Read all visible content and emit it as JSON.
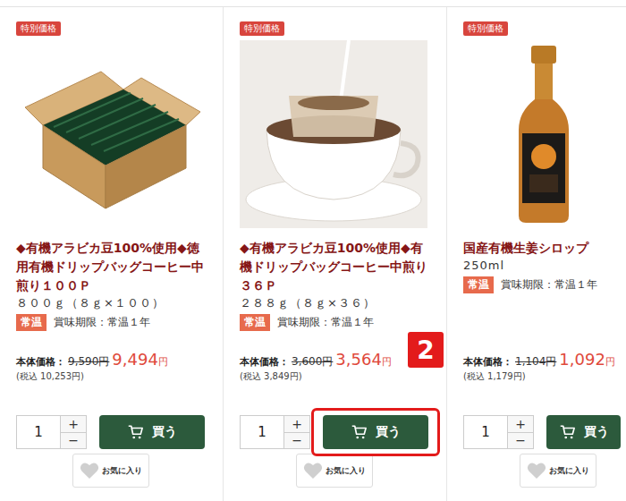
{
  "products": [
    {
      "badge": "特別価格",
      "kind": "box",
      "title": "◆有機アラビカ豆100%使用◆徳用有機ドリップバッグコーヒー中煎り１００Ｐ",
      "spec": "８００ｇ（８ｇ×１００）",
      "storage": "常温",
      "expiry": "賞味期限：常温１年",
      "price_label": "本体価格：",
      "original_price": "9,590円",
      "sale_price": "9,494",
      "sale_unit": "円",
      "tax_price": "(税込 10,253円)",
      "quantity": "1",
      "buy": "買う",
      "favorite": "お気に入り",
      "highlighted": false
    },
    {
      "badge": "特別価格",
      "kind": "coffee",
      "title": "◆有機アラビカ豆100%使用◆有機ドリップバッグコーヒー中煎り３６Ｐ",
      "spec": "２８８ｇ（８ｇ×３６）",
      "storage": "常温",
      "expiry": "賞味期限：常温１年",
      "price_label": "本体価格：",
      "original_price": "3,600円",
      "sale_price": "3,564",
      "sale_unit": "円",
      "tax_price": "(税込 3,849円)",
      "quantity": "1",
      "buy": "買う",
      "favorite": "お気に入り",
      "highlighted": true
    },
    {
      "badge": "特別価格",
      "kind": "bottle",
      "title": "国産有機生姜シロップ",
      "spec": "250ml",
      "storage": "常温",
      "expiry": "賞味期限：常温１年",
      "price_label": "本体価格：",
      "original_price": "1,104円",
      "sale_price": "1,092",
      "sale_unit": "円",
      "tax_price": "(税込 1,179円)",
      "quantity": "1",
      "buy": "買う",
      "favorite": "お気に入り",
      "highlighted": false
    }
  ],
  "quantity_controls": {
    "plus": "+",
    "minus": "−"
  },
  "annotation": {
    "label": "2"
  }
}
